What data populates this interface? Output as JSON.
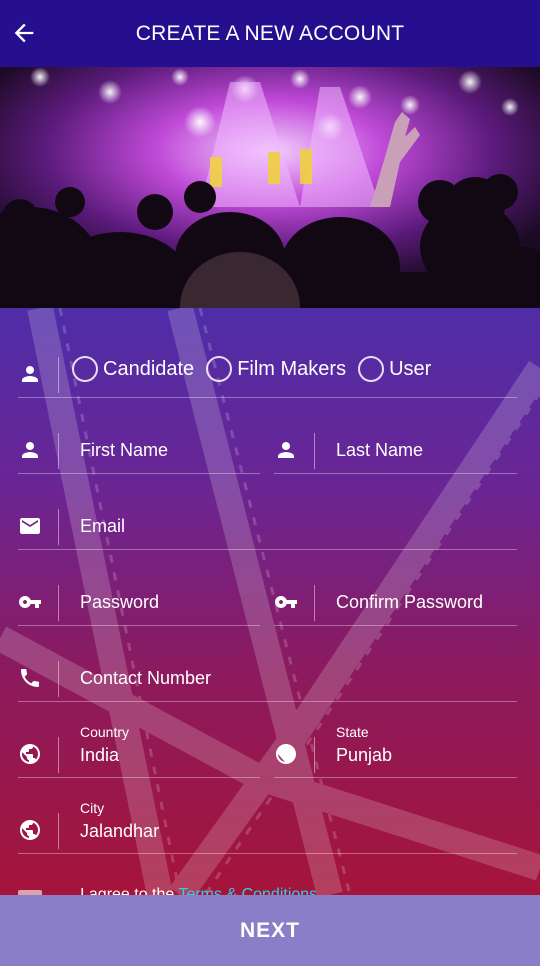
{
  "header": {
    "title": "CREATE A NEW ACCOUNT",
    "back_icon": "arrow-left-icon"
  },
  "account_type": {
    "icon": "person-icon",
    "options": [
      "Candidate",
      "Film Makers",
      "User"
    ]
  },
  "fields": {
    "first_name": {
      "placeholder": "First Name",
      "icon": "person-icon"
    },
    "last_name": {
      "placeholder": "Last Name",
      "icon": "person-icon"
    },
    "email": {
      "placeholder": "Email",
      "icon": "email-icon"
    },
    "password": {
      "placeholder": "Password",
      "icon": "key-icon"
    },
    "confirm_password": {
      "placeholder": "Confirm Password",
      "icon": "key-icon"
    },
    "contact_number": {
      "placeholder": "Contact Number",
      "icon": "phone-icon"
    },
    "country": {
      "label": "Country",
      "value": "India",
      "icon": "globe-icon"
    },
    "state": {
      "label": "State",
      "value": "Punjab",
      "icon": "globe-icon"
    },
    "city": {
      "label": "City",
      "value": "Jalandhar",
      "icon": "globe-icon"
    }
  },
  "terms": {
    "prefix": "I agree to the ",
    "link": "Terms & Conditions"
  },
  "footer": {
    "next_label": "NEXT"
  },
  "colors": {
    "appbar": "#250f8f",
    "next_button": "#8b7ec8",
    "link": "#2fd0e8"
  }
}
